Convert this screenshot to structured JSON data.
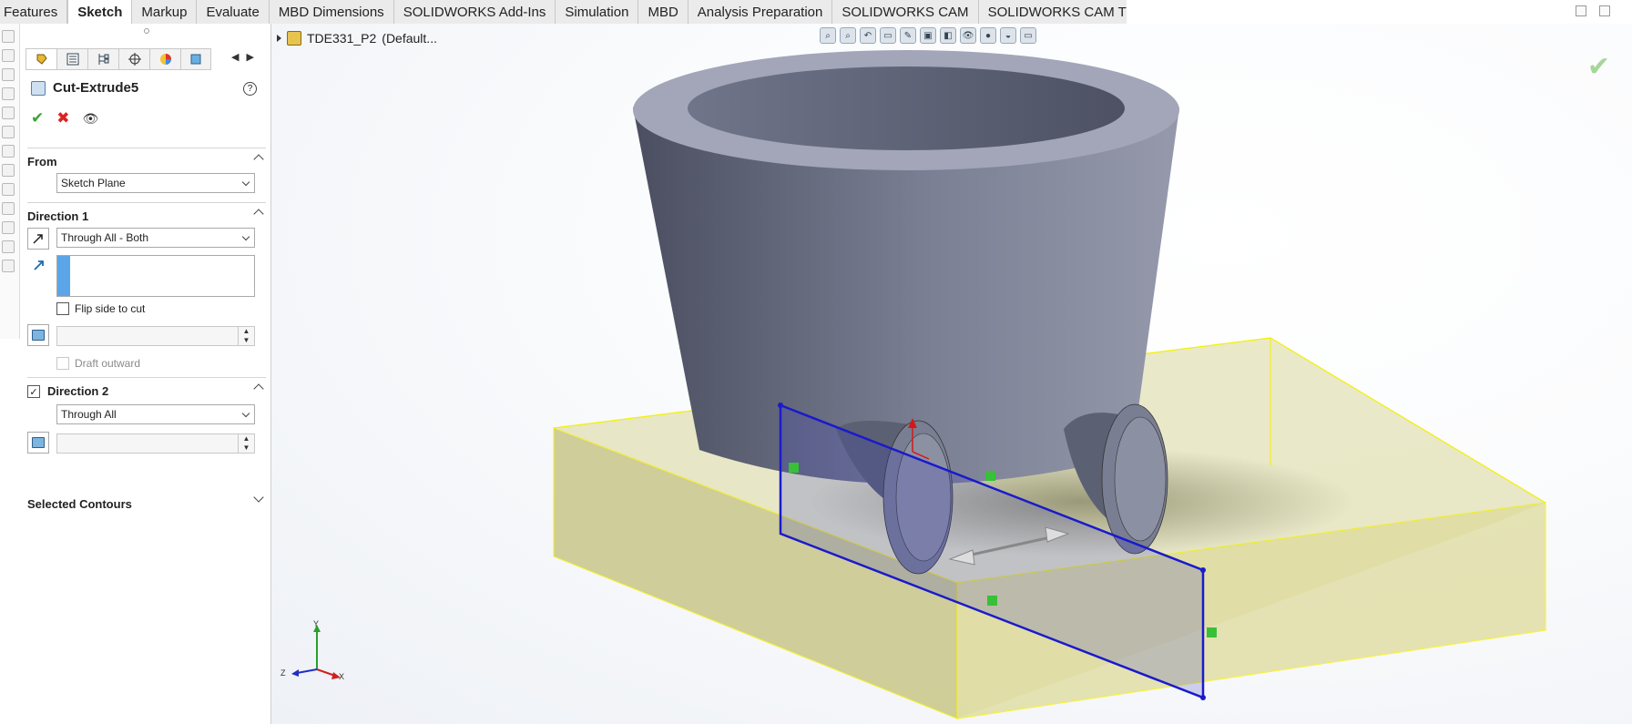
{
  "ribbon": {
    "tabs": [
      "Features",
      "Sketch",
      "Markup",
      "Evaluate",
      "MBD Dimensions",
      "SOLIDWORKS Add-Ins",
      "Simulation",
      "MBD",
      "Analysis Preparation",
      "SOLIDWORKS CAM",
      "SOLIDWORKS CAM TBM"
    ],
    "active_tab": "Sketch"
  },
  "property_manager": {
    "title": "Cut-Extrude5",
    "help_glyph": "?",
    "from": {
      "label": "From",
      "value": "Sketch Plane"
    },
    "direction1": {
      "label": "Direction 1",
      "end_condition": "Through All - Both",
      "flip_side_label": "Flip side to cut",
      "flip_side_checked": false,
      "draft_outward_label": "Draft outward",
      "draft_outward_enabled": false
    },
    "direction2": {
      "label": "Direction 2",
      "checked": true,
      "end_condition": "Through All"
    },
    "selected_contours": {
      "label": "Selected Contours",
      "expanded": false
    }
  },
  "feature_tree": {
    "part_name": "TDE331_P2",
    "configuration": "(Default..."
  },
  "triad": {
    "x_label": "X",
    "y_label": "Y",
    "z_label": "Z"
  },
  "colors": {
    "body": "#6f7387",
    "extrude_preview": "#e8e6a0",
    "preview_edge": "#ffff00",
    "sketch_line": "#1a1acc",
    "ok_green": "#3aa335",
    "cancel_red": "#dd2222"
  }
}
